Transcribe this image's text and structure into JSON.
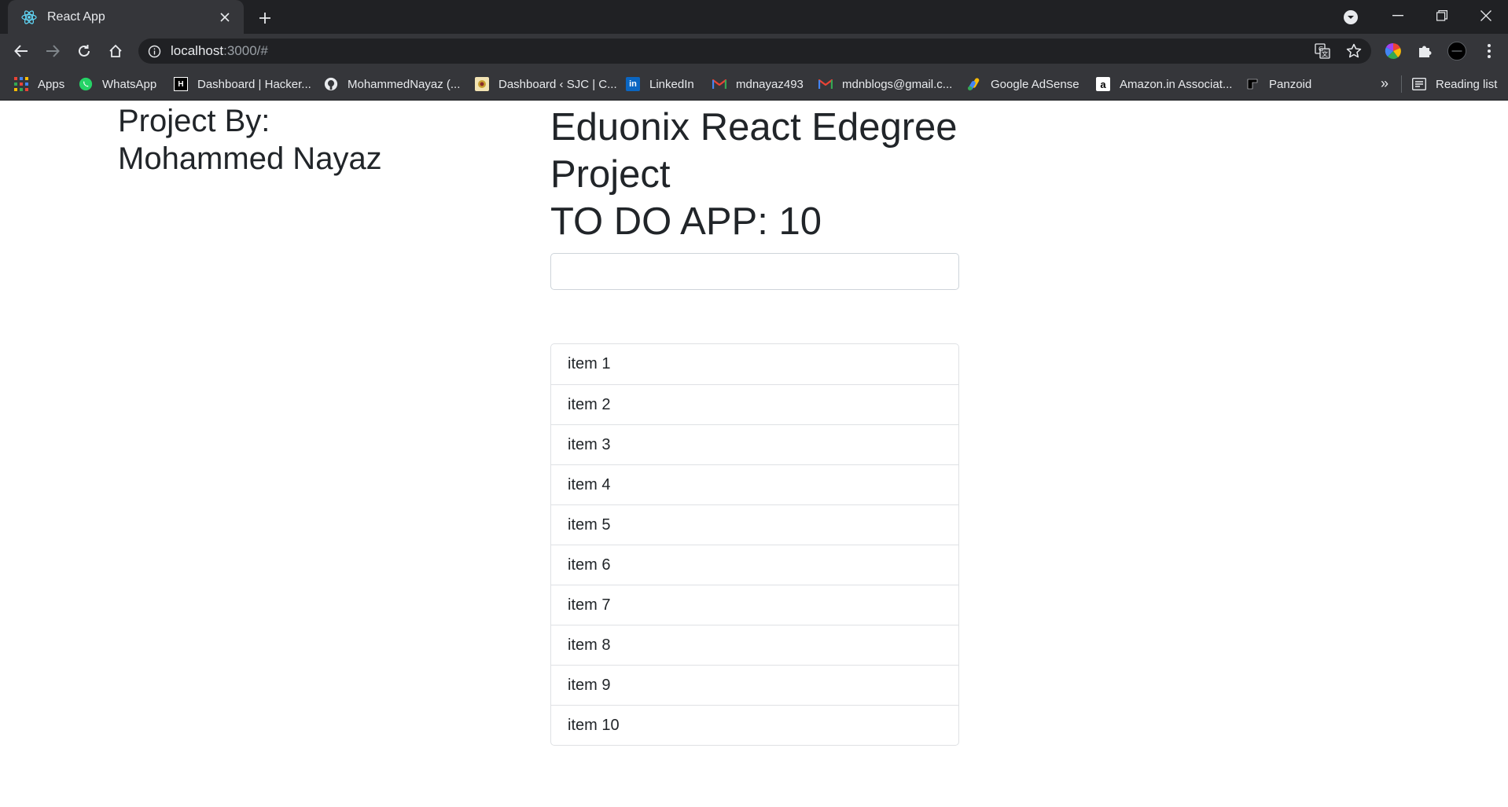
{
  "browser": {
    "tab_title": "React App",
    "url_host": "localhost",
    "url_rest": ":3000/#",
    "bookmarks": [
      {
        "label": "Apps",
        "icon": "apps-grid-icon"
      },
      {
        "label": "WhatsApp",
        "icon": "whatsapp-icon"
      },
      {
        "label": "Dashboard | Hacker...",
        "icon": "hackerrank-icon"
      },
      {
        "label": "MohammedNayaz (...",
        "icon": "github-icon"
      },
      {
        "label": "Dashboard ‹ SJC | C...",
        "icon": "sjc-icon"
      },
      {
        "label": "LinkedIn",
        "icon": "linkedin-icon"
      },
      {
        "label": "mdnayaz493",
        "icon": "gmail-icon"
      },
      {
        "label": "mdnblogs@gmail.c...",
        "icon": "gmail-icon"
      },
      {
        "label": "Google AdSense",
        "icon": "adsense-icon"
      },
      {
        "label": "Amazon.in Associat...",
        "icon": "amazon-icon"
      },
      {
        "label": "Panzoid",
        "icon": "panzoid-icon"
      }
    ],
    "overflow": "»",
    "reading_list": "Reading list"
  },
  "page": {
    "author_line1": "Project By:",
    "author_line2": "Mohammed Nayaz",
    "title_line1": "Eduonix React Edegree",
    "title_line2": "Project",
    "title_line3": "TO DO APP: 10",
    "input_value": "",
    "items": [
      "item 1",
      "item 2",
      "item 3",
      "item 4",
      "item 5",
      "item 6",
      "item 7",
      "item 8",
      "item 9",
      "item 10"
    ]
  }
}
